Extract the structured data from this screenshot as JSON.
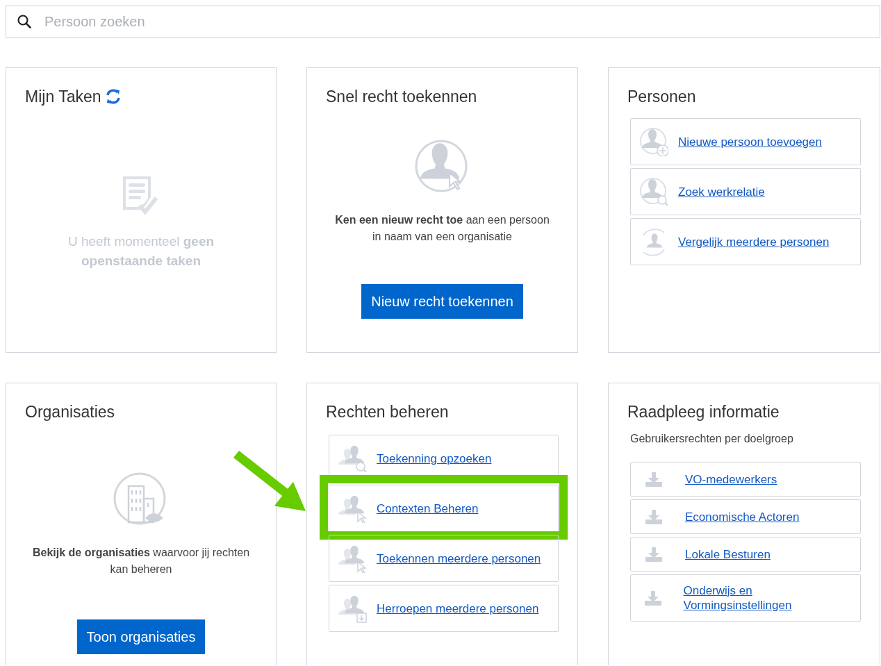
{
  "search": {
    "placeholder": "Persoon zoeken"
  },
  "cards": [
    {
      "kind": "tasks",
      "title": "Mijn Taken",
      "message": "U heeft momenteel **geen openstaande taken**"
    },
    {
      "kind": "action",
      "title": "Snel recht toekennen",
      "emblem": {
        "kind": "person"
      },
      "text": "**Ken een nieuw recht toe** aan een persoon in naam van een organisatie",
      "button": "Nieuw recht toekennen"
    },
    {
      "kind": "links",
      "title": "Personen",
      "links": [
        {
          "label": "Nieuwe persoon toevoegen",
          "kind": "person-add",
          "highlighted": false
        },
        {
          "label": "Zoek werkrelatie",
          "kind": "person-search",
          "highlighted": false
        },
        {
          "label": "Vergelijk meerdere personen",
          "kind": "person-compare",
          "highlighted": false
        }
      ]
    },
    {
      "kind": "action",
      "title": "Organisaties",
      "emblem": {
        "kind": "building"
      },
      "text": "**Bekijk de organisaties** waarvoor jij rechten kan beheren",
      "button": "Toon organisaties"
    },
    {
      "kind": "links",
      "title": "Rechten beheren",
      "links": [
        {
          "label": "Toekenning opzoeken",
          "kind": "people-search",
          "highlighted": false
        },
        {
          "label": "Contexten Beheren",
          "kind": "people-pointer",
          "highlighted": true
        },
        {
          "label": "Toekennen meerdere personen",
          "kind": "people-pointer",
          "highlighted": false
        },
        {
          "label": "Herroepen meerdere personen",
          "kind": "people-download",
          "highlighted": false
        }
      ]
    },
    {
      "kind": "links",
      "title": "Raadpleeg informatie",
      "subtitle": "Gebruikersrechten per doelgroep",
      "links": [
        {
          "label": "VO-medewerkers",
          "kind": "download",
          "highlighted": false
        },
        {
          "label": "Economische Actoren",
          "kind": "download",
          "highlighted": false
        },
        {
          "label": "Lokale Besturen",
          "kind": "download",
          "highlighted": false
        },
        {
          "label": "Onderwijs en Vormingsinstellingen",
          "kind": "download",
          "highlighted": false
        }
      ]
    }
  ]
}
